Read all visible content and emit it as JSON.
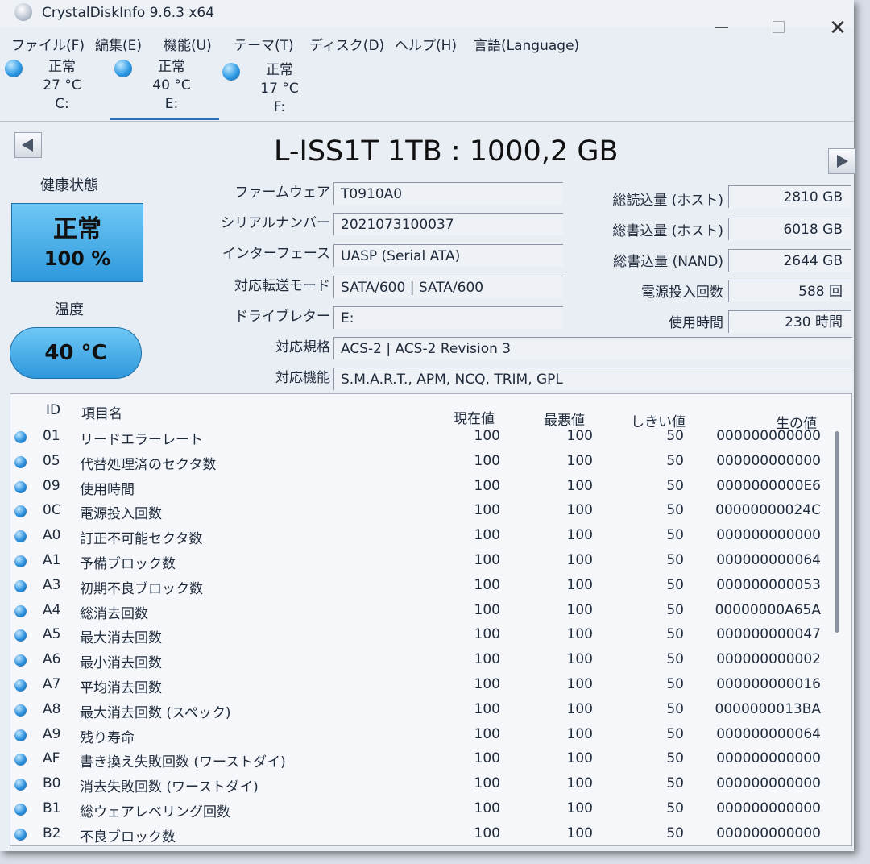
{
  "window": {
    "title": "CrystalDiskInfo 9.6.3 x64",
    "icon": "crystal-disk-icon"
  },
  "menu": [
    "ファイル(F)",
    "編集(E)",
    "機能(U)",
    "テーマ(T)",
    "ディスク(D)",
    "ヘルプ(H)",
    "言語(Language)"
  ],
  "disks": [
    {
      "status": "正常",
      "temp": "27 °C",
      "drive": "C:"
    },
    {
      "status": "正常",
      "temp": "40 °C",
      "drive": "E:"
    },
    {
      "status": "正常",
      "temp": "17 °C",
      "drive": "F:"
    }
  ],
  "model": "L-ISS1T 1TB : 1000,2 GB",
  "health": {
    "label": "健康状態",
    "status": "正常",
    "percent": "100 %"
  },
  "temperature": {
    "label": "温度",
    "value": "40 °C"
  },
  "info": {
    "firmware_label": "ファームウェア",
    "firmware": "T0910A0",
    "serial_label": "シリアルナンバー",
    "serial": "2021073100037",
    "interface_label": "インターフェース",
    "interface": "UASP (Serial ATA)",
    "transfer_label": "対応転送モード",
    "transfer": "SATA/600 | SATA/600",
    "drive_label": "ドライブレター",
    "drive": "E:",
    "standard_label": "対応規格",
    "standard": "ACS-2 | ACS-2 Revision 3",
    "features_label": "対応機能",
    "features": "S.M.A.R.T., APM, NCQ, TRIM, GPL"
  },
  "stats": {
    "host_reads_label": "総読込量 (ホスト)",
    "host_reads": "2810 GB",
    "host_writes_label": "総書込量 (ホスト)",
    "host_writes": "6018 GB",
    "nand_writes_label": "総書込量 (NAND)",
    "nand_writes": "2644 GB",
    "power_count_label": "電源投入回数",
    "power_count": "588 回",
    "power_hours_label": "使用時間",
    "power_hours": "230 時間"
  },
  "smart": {
    "headers": {
      "id": "ID",
      "name": "項目名",
      "current": "現在値",
      "worst": "最悪値",
      "threshold": "しきい値",
      "raw": "生の値"
    },
    "rows": [
      {
        "id": "01",
        "name": "リードエラーレート",
        "current": "100",
        "worst": "100",
        "threshold": "50",
        "raw": "000000000000"
      },
      {
        "id": "05",
        "name": "代替処理済のセクタ数",
        "current": "100",
        "worst": "100",
        "threshold": "50",
        "raw": "000000000000"
      },
      {
        "id": "09",
        "name": "使用時間",
        "current": "100",
        "worst": "100",
        "threshold": "50",
        "raw": "0000000000E6"
      },
      {
        "id": "0C",
        "name": "電源投入回数",
        "current": "100",
        "worst": "100",
        "threshold": "50",
        "raw": "00000000024C"
      },
      {
        "id": "A0",
        "name": "訂正不可能セクタ数",
        "current": "100",
        "worst": "100",
        "threshold": "50",
        "raw": "000000000000"
      },
      {
        "id": "A1",
        "name": "予備ブロック数",
        "current": "100",
        "worst": "100",
        "threshold": "50",
        "raw": "000000000064"
      },
      {
        "id": "A3",
        "name": "初期不良ブロック数",
        "current": "100",
        "worst": "100",
        "threshold": "50",
        "raw": "000000000053"
      },
      {
        "id": "A4",
        "name": "総消去回数",
        "current": "100",
        "worst": "100",
        "threshold": "50",
        "raw": "00000000A65A"
      },
      {
        "id": "A5",
        "name": "最大消去回数",
        "current": "100",
        "worst": "100",
        "threshold": "50",
        "raw": "000000000047"
      },
      {
        "id": "A6",
        "name": "最小消去回数",
        "current": "100",
        "worst": "100",
        "threshold": "50",
        "raw": "000000000002"
      },
      {
        "id": "A7",
        "name": "平均消去回数",
        "current": "100",
        "worst": "100",
        "threshold": "50",
        "raw": "000000000016"
      },
      {
        "id": "A8",
        "name": "最大消去回数 (スペック)",
        "current": "100",
        "worst": "100",
        "threshold": "50",
        "raw": "0000000013BA"
      },
      {
        "id": "A9",
        "name": "残り寿命",
        "current": "100",
        "worst": "100",
        "threshold": "50",
        "raw": "000000000064"
      },
      {
        "id": "AF",
        "name": "書き換え失敗回数 (ワーストダイ)",
        "current": "100",
        "worst": "100",
        "threshold": "50",
        "raw": "000000000000"
      },
      {
        "id": "B0",
        "name": "消去失敗回数 (ワーストダイ)",
        "current": "100",
        "worst": "100",
        "threshold": "50",
        "raw": "000000000000"
      },
      {
        "id": "B1",
        "name": "総ウェアレベリング回数",
        "current": "100",
        "worst": "100",
        "threshold": "50",
        "raw": "000000000000"
      },
      {
        "id": "B2",
        "name": "不良ブロック数",
        "current": "100",
        "worst": "100",
        "threshold": "50",
        "raw": "000000000000"
      }
    ]
  },
  "colors": {
    "status_good": "#2e98dc",
    "background": "#e9edf4"
  }
}
